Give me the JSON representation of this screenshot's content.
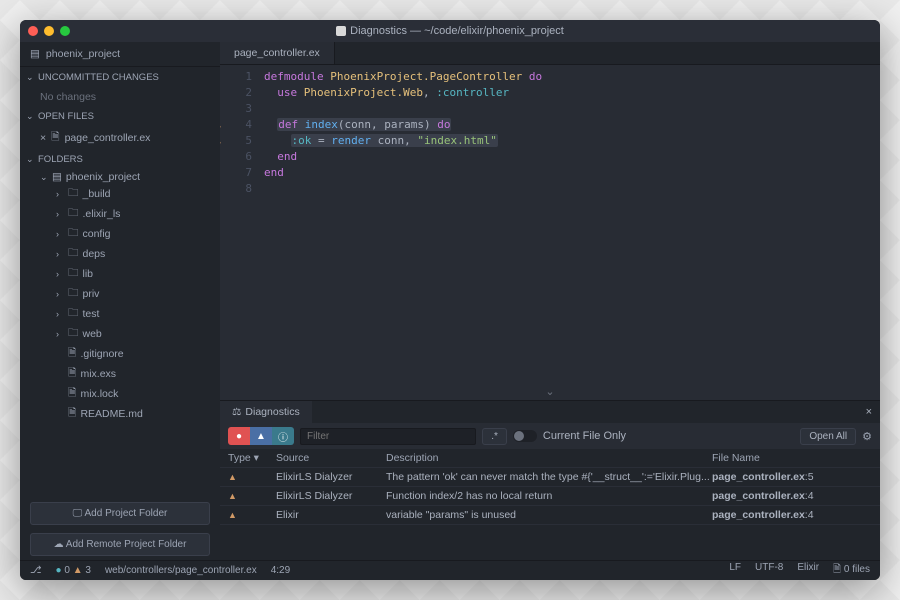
{
  "window": {
    "title": "Diagnostics — ~/code/elixir/phoenix_project"
  },
  "sidebar": {
    "project_tab": "phoenix_project",
    "sections": {
      "uncommitted": {
        "label": "UNCOMMITTED CHANGES",
        "no_changes": "No changes"
      },
      "open_files": {
        "label": "OPEN FILES",
        "file": "page_controller.ex"
      },
      "folders": {
        "label": "FOLDERS",
        "root": "phoenix_project",
        "items": [
          "_build",
          ".elixir_ls",
          "config",
          "deps",
          "lib",
          "priv",
          "test",
          "web"
        ],
        "files": [
          ".gitignore",
          "mix.exs",
          "mix.lock",
          "README.md"
        ]
      }
    },
    "add_project": "Add Project Folder",
    "add_remote": "Add Remote Project Folder"
  },
  "editor": {
    "tab": "page_controller.ex",
    "lines": [
      1,
      2,
      3,
      4,
      5,
      6,
      7,
      8
    ],
    "code": {
      "l1_defmodule": "defmodule",
      "l1_mod": "PhoenixProject.PageController",
      "l1_do": "do",
      "l2_use": "use",
      "l2_mod": "PhoenixProject.Web",
      "l2_atom": ":controller",
      "l4_def": "def",
      "l4_fn": "index",
      "l4_args": "(conn, params)",
      "l4_do": "do",
      "l5_ok": ":ok",
      "l5_eq": " = ",
      "l5_render": "render",
      "l5_conn": " conn, ",
      "l5_str": "\"index.html\"",
      "l6": "end",
      "l7": "end"
    }
  },
  "diagnostics": {
    "title": "Diagnostics",
    "filter_placeholder": "Filter",
    "regex_btn": ".*",
    "current_file": "Current File Only",
    "open_all": "Open All",
    "headers": {
      "type": "Type",
      "source": "Source",
      "description": "Description",
      "file": "File Name"
    },
    "rows": [
      {
        "source": "ElixirLS Dialyzer",
        "desc": "The pattern 'ok' can never match the type #{'__struct__':='Elixir.Plug...",
        "file": "page_controller.ex",
        "loc": ":5"
      },
      {
        "source": "ElixirLS Dialyzer",
        "desc": "Function index/2 has no local return",
        "file": "page_controller.ex",
        "loc": ":4"
      },
      {
        "source": "Elixir",
        "desc": "variable \"params\" is unused",
        "file": "page_controller.ex",
        "loc": ":4"
      }
    ]
  },
  "statusbar": {
    "errors": "0",
    "warnings": "3",
    "path": "web/controllers/page_controller.ex",
    "cursor": "4:29",
    "lf": "LF",
    "encoding": "UTF-8",
    "language": "Elixir",
    "files": "0 files"
  }
}
